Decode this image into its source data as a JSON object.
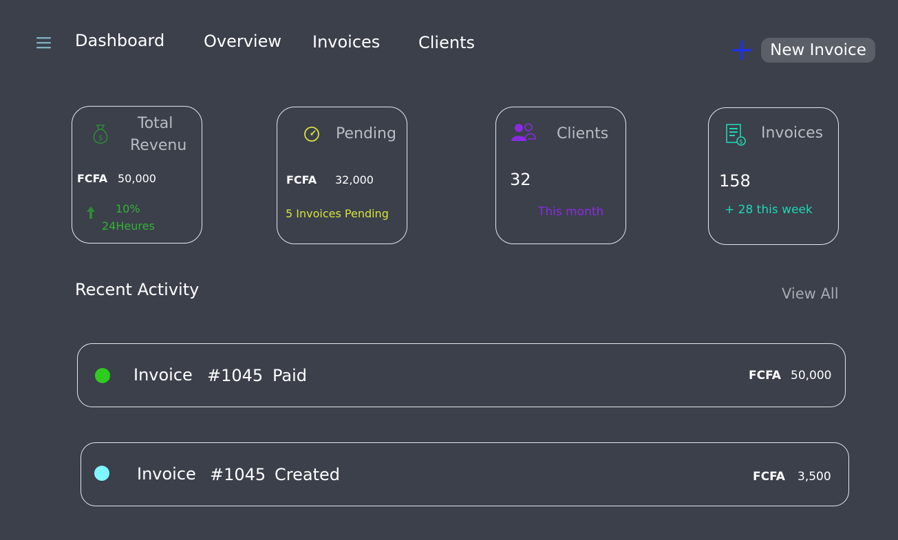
{
  "header": {
    "nav": [
      "Dashboard",
      "Overview",
      "Invoices",
      "Clients"
    ],
    "new_invoice_label": "New Invoice",
    "menu_icon": "hamburger-menu-icon",
    "plus_icon": "plus-icon"
  },
  "cards": {
    "revenue": {
      "title_line1": "Total",
      "title_line2": "Revenu",
      "currency": "FCFA",
      "amount": "50,000",
      "change": "10%",
      "period": "24Heures",
      "icon": "money-bag-icon",
      "trend_icon": "arrow-up-icon",
      "accent": "#34b233"
    },
    "pending": {
      "title": "Pending",
      "currency": "FCFA",
      "amount": "32,000",
      "note": "5 Invoices Pending",
      "icon": "gauge-icon",
      "accent": "#d9e23b"
    },
    "clients": {
      "title": "Clients",
      "value": "32",
      "note": "This month",
      "icon": "users-icon",
      "accent": "#8a2be2"
    },
    "invoices": {
      "title": "Invoices",
      "value": "158",
      "note": "+ 28 this week",
      "icon": "invoice-icon",
      "accent": "#1fd6b3"
    }
  },
  "activity": {
    "title": "Recent Activity",
    "view_all": "View All",
    "rows": [
      {
        "label": "Invoice",
        "number": "#1045",
        "status": "Paid",
        "currency": "FCFA",
        "amount": "50,000",
        "dot_color": "#2ecc1f"
      },
      {
        "label": "Invoice",
        "number": "#1045",
        "status": "Created",
        "currency": "FCFA",
        "amount": "3,500",
        "dot_color": "#7ff6ff"
      }
    ]
  }
}
